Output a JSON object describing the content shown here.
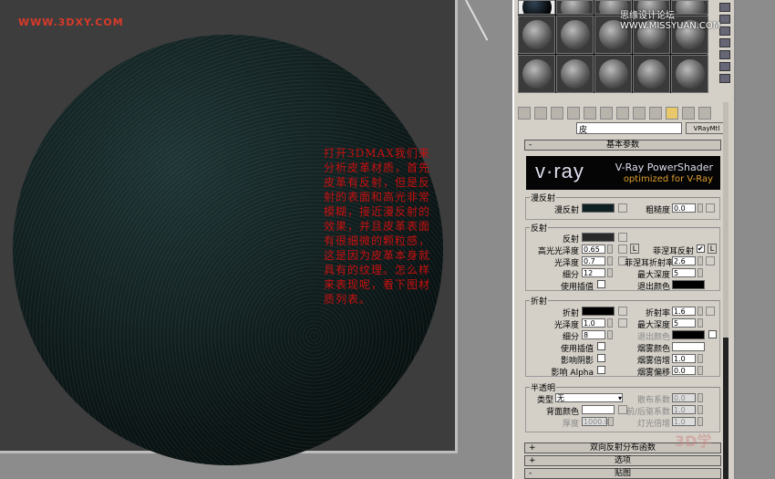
{
  "logo": "WWW.3DXY.COM",
  "watermark": "思缘设计论坛 WWW.MISSYUAN.COM",
  "watermark2": "3D学",
  "note": "打开3DMAX我们来分析皮革材质，首先皮革有反射，但是反射的表面和高光非常模糊，接近漫反射的效果，并且皮革表面有很细微的颗粒感，这是因为皮革本身就具有的纹理。怎么样来表现呢，看下图材质列表。",
  "material": {
    "name": "皮",
    "type": "VRayMtl"
  },
  "rollouts": {
    "basic": "基本参数",
    "brdf": "双向反射分布函数",
    "options": "选项",
    "maps": "贴图"
  },
  "banner": {
    "title": "V-Ray PowerShader",
    "subtitle": "optimized for V-Ray",
    "logo": "v·ray"
  },
  "diffuse": {
    "group": "漫反射",
    "label": "漫反射",
    "color": "#0f2022",
    "roughness_label": "粗糙度",
    "roughness": "0.0"
  },
  "reflection": {
    "group": "反射",
    "label": "反射",
    "color": "#2a2a2a",
    "hilight_label": "高光光泽度",
    "hilight": "0.65",
    "gloss_label": "光泽度",
    "gloss": "0.7",
    "subdivs_label": "细分",
    "subdivs": "12",
    "interp_label": "使用插值",
    "fresnel_label": "菲涅耳反射",
    "fresnel_checked": true,
    "fresnel_ior_label": "菲涅耳折射率",
    "fresnel_ior": "2.6",
    "depth_label": "最大深度",
    "depth": "5",
    "exit_label": "退出颜色",
    "exit_color": "#000000",
    "L": "L"
  },
  "refraction": {
    "group": "折射",
    "label": "折射",
    "color": "#000000",
    "gloss_label": "光泽度",
    "gloss": "1.0",
    "subdivs_label": "细分",
    "subdivs": "8",
    "interp_label": "使用插值",
    "shadows_label": "影响阴影",
    "alpha_label": "影响 Alpha",
    "ior_label": "折射率",
    "ior": "1.6",
    "depth_label": "最大深度",
    "depth": "5",
    "exit_label": "退出颜色",
    "fog_color_label": "烟雾颜色",
    "fog_mult_label": "烟雾倍增",
    "fog_mult": "1.0",
    "fog_bias_label": "烟雾偏移",
    "fog_bias": "0.0"
  },
  "translucency": {
    "group": "半透明",
    "type_label": "类型",
    "type": "无",
    "back_label": "背面颜色",
    "thickness_label": "厚度",
    "thickness": "1000.0",
    "scatter_label": "散布系数",
    "scatter": "0.0",
    "fwdbck_label": "前/后驱系数",
    "fwdbck": "1.0",
    "light_label": "灯光倍增",
    "light": "1.0"
  }
}
